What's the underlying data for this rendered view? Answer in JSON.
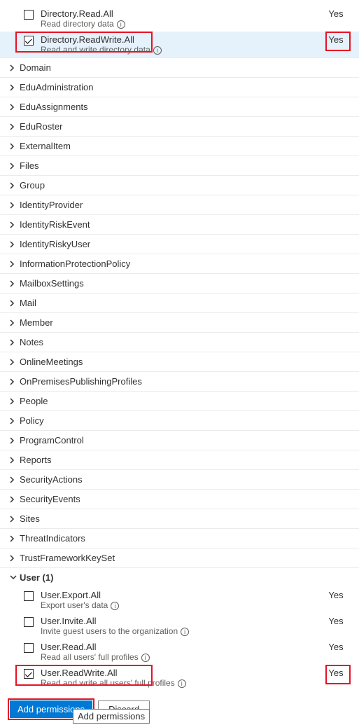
{
  "directory_permissions": [
    {
      "name": "Directory.Read.All",
      "desc": "Read directory data",
      "checked": false,
      "consent": "Yes",
      "highlight": false,
      "redbox": false
    },
    {
      "name": "Directory.ReadWrite.All",
      "desc": "Read and write directory data",
      "checked": true,
      "consent": "Yes",
      "highlight": true,
      "redbox": true
    }
  ],
  "groups": [
    {
      "label": "Domain"
    },
    {
      "label": "EduAdministration"
    },
    {
      "label": "EduAssignments"
    },
    {
      "label": "EduRoster"
    },
    {
      "label": "ExternalItem"
    },
    {
      "label": "Files"
    },
    {
      "label": "Group"
    },
    {
      "label": "IdentityProvider"
    },
    {
      "label": "IdentityRiskEvent"
    },
    {
      "label": "IdentityRiskyUser"
    },
    {
      "label": "InformationProtectionPolicy"
    },
    {
      "label": "MailboxSettings"
    },
    {
      "label": "Mail"
    },
    {
      "label": "Member"
    },
    {
      "label": "Notes"
    },
    {
      "label": "OnlineMeetings"
    },
    {
      "label": "OnPremisesPublishingProfiles"
    },
    {
      "label": "People"
    },
    {
      "label": "Policy"
    },
    {
      "label": "ProgramControl"
    },
    {
      "label": "Reports"
    },
    {
      "label": "SecurityActions"
    },
    {
      "label": "SecurityEvents"
    },
    {
      "label": "Sites"
    },
    {
      "label": "ThreatIndicators"
    },
    {
      "label": "TrustFrameworkKeySet"
    }
  ],
  "user_group": {
    "label": "User (1)"
  },
  "user_permissions": [
    {
      "name": "User.Export.All",
      "desc": "Export user's data",
      "checked": false,
      "consent": "Yes",
      "highlight": false,
      "redbox": false
    },
    {
      "name": "User.Invite.All",
      "desc": "Invite guest users to the organization",
      "checked": false,
      "consent": "Yes",
      "highlight": false,
      "redbox": false
    },
    {
      "name": "User.Read.All",
      "desc": "Read all users' full profiles",
      "checked": false,
      "consent": "Yes",
      "highlight": false,
      "redbox": false
    },
    {
      "name": "User.ReadWrite.All",
      "desc": "Read and write all users' full profiles",
      "checked": true,
      "consent": "Yes",
      "highlight": false,
      "redbox": true
    }
  ],
  "buttons": {
    "add": "Add permissions",
    "discard": "Discard"
  },
  "tooltip": "Add permissions",
  "info_glyph": "i"
}
